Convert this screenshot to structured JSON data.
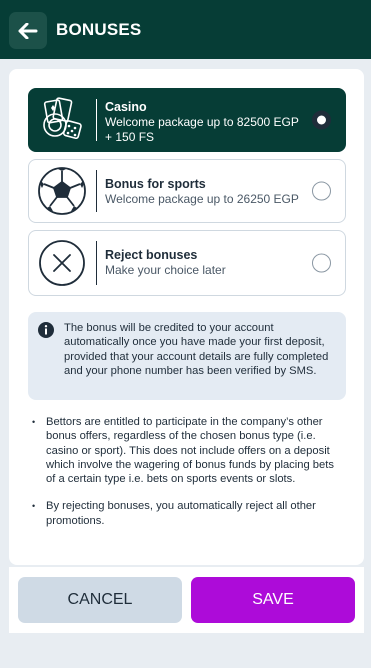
{
  "header": {
    "title": "BONUSES",
    "back_icon": "arrow-left-icon"
  },
  "options": [
    {
      "icon": "casino-cards-dice-icon",
      "title": "Casino",
      "subtitle": "Welcome package up to 82500 EGP + 150 FS",
      "selected": true
    },
    {
      "icon": "soccer-ball-icon",
      "title": "Bonus for sports",
      "subtitle": "Welcome package up to 26250 EGP",
      "selected": false
    },
    {
      "icon": "reject-x-circle-icon",
      "title": "Reject bonuses",
      "subtitle": "Make your choice later",
      "selected": false
    }
  ],
  "info": {
    "icon": "info-icon",
    "text": "The bonus will be credited to your account automatically once you have made your first deposit, provided that your account details are fully completed and your phone number has been verified by SMS."
  },
  "bullets": [
    "Bettors are entitled to participate in the company’s other bonus offers, regardless of the chosen bonus type (i.e. casino or sport). This does not include offers on a deposit which involve the wagering of bonus funds by placing bets of a certain type i.e. bets on sports events or slots.",
    "By rejecting bonuses, you automatically reject all other promotions."
  ],
  "buttons": {
    "cancel": "CANCEL",
    "save": "SAVE"
  },
  "colors": {
    "header_bg": "#063d36",
    "selected_bg": "#063d36",
    "save_bg": "#ad0bd9",
    "cancel_bg": "#cfdae5",
    "info_bg": "#e4ebf3"
  }
}
